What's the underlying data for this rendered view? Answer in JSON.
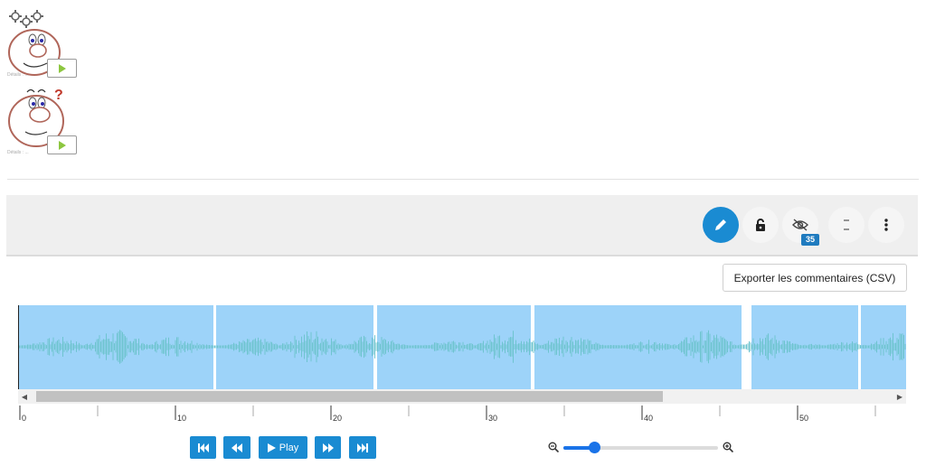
{
  "thumbnails": [
    {
      "name": "character-thumbnail-1",
      "caption": "Détails : ..."
    },
    {
      "name": "character-thumbnail-2",
      "caption": "Détails : ..."
    }
  ],
  "toolbar": {
    "buttons": [
      {
        "name": "edit-button",
        "icon": "pencil-icon"
      },
      {
        "name": "lock-button",
        "icon": "unlock-icon"
      },
      {
        "name": "visibility-button",
        "icon": "eye-off-icon",
        "badge": "35"
      },
      {
        "name": "split-view-button",
        "icon": "split-icon"
      },
      {
        "name": "more-options-button",
        "icon": "kebab-icon"
      }
    ],
    "accent_color": "#1a8bd2"
  },
  "export_label": "Exporter les commentaires (CSV)",
  "waveform": {
    "region_color": "#9dd3f9",
    "wave_color": "#6ec4cf",
    "scroll_position": 0.0
  },
  "timeline": {
    "labels": [
      "0",
      "10",
      "20",
      "30",
      "40",
      "50"
    ]
  },
  "transport": {
    "skip_back_icon": "skip-back-icon",
    "rewind_icon": "rewind-icon",
    "play_label": "Play",
    "forward_icon": "fast-forward-icon",
    "skip_forward_icon": "skip-forward-icon"
  },
  "zoom": {
    "zoom_out_icon": "zoom-out-icon",
    "zoom_in_icon": "zoom-in-icon",
    "level": 0.2
  }
}
